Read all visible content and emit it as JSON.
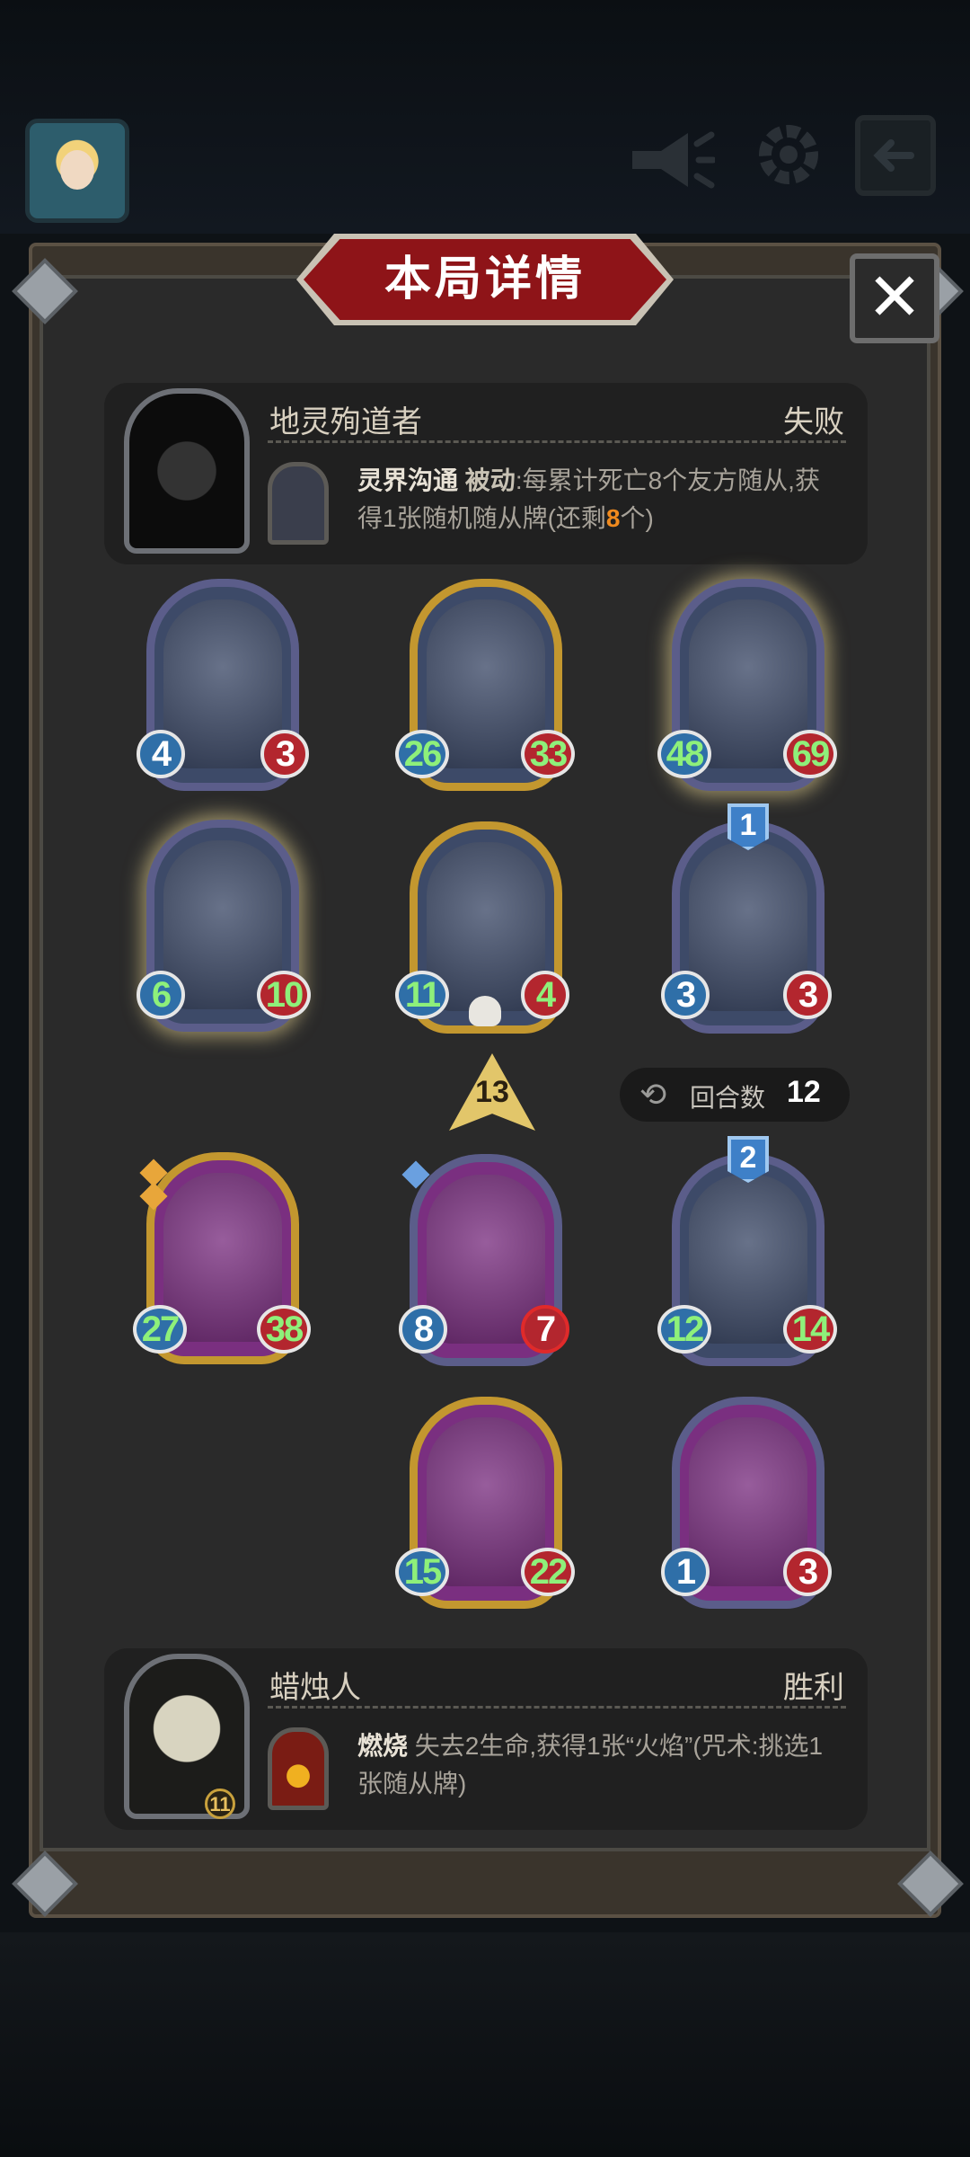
{
  "title": "本局详情",
  "close_icon": "close-icon",
  "top_bar": {
    "icons": [
      "avatar",
      "megaphone-icon",
      "gear-icon",
      "exit-icon"
    ]
  },
  "opponent": {
    "name": "地灵殉道者",
    "result": "失败",
    "skill": {
      "name": "灵界沟通",
      "tag": "被动",
      "desc_pre": ":每累计死亡8个友方随从,获得1张随机随从牌(还剩",
      "remaining": "8",
      "desc_post": "个)"
    }
  },
  "player": {
    "name": "蜡烛人",
    "result": "胜利",
    "skill": {
      "name": "燃烧",
      "desc": " 失去2生命,获得1张“火焰”(咒术:挑选1张随从牌)",
      "cost": "11"
    }
  },
  "round_badge": "13",
  "turns": {
    "label": "回合数",
    "value": "12"
  },
  "opponent_board": [
    {
      "atk": "4",
      "hp": "3"
    },
    {
      "atk": "26",
      "hp": "33"
    },
    {
      "atk": "48",
      "hp": "69"
    },
    {
      "atk": "6",
      "hp": "10"
    },
    {
      "atk": "11",
      "hp": "4"
    },
    {
      "atk": "3",
      "hp": "3",
      "level": "1"
    }
  ],
  "player_board": [
    {
      "atk": "27",
      "hp": "38"
    },
    {
      "atk": "8",
      "hp": "7"
    },
    {
      "atk": "12",
      "hp": "14",
      "level": "2"
    },
    {
      "atk": "15",
      "hp": "22"
    },
    {
      "atk": "1",
      "hp": "3"
    }
  ]
}
